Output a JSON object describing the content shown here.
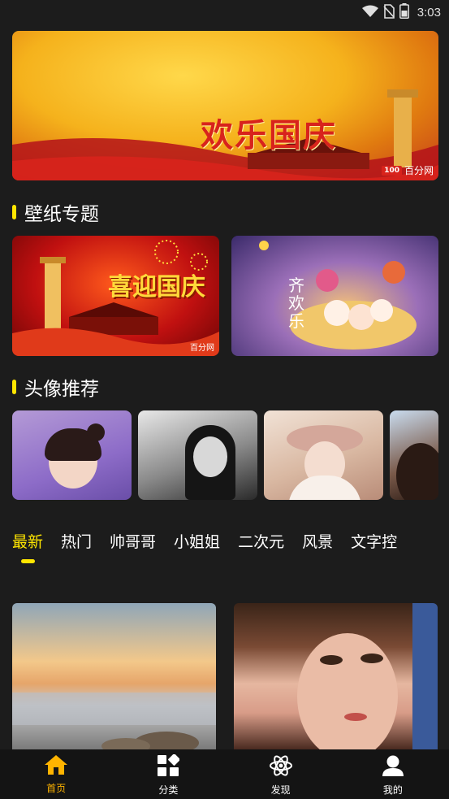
{
  "status_bar": {
    "time": "3:03",
    "icons": [
      "wifi-icon",
      "no-sim-icon",
      "battery-icon"
    ]
  },
  "banner": {
    "title": "欢乐国庆",
    "watermark": "百分网",
    "watermark_logo": "100"
  },
  "wallpaper_section": {
    "title": "壁纸专题",
    "topics": [
      {
        "title": "喜迎国庆",
        "watermark": "百分网"
      },
      {
        "title": "齐欢乐"
      }
    ]
  },
  "avatar_section": {
    "title": "头像推荐",
    "count_visible": 4
  },
  "category_tabs": {
    "items": [
      "最新",
      "热门",
      "帅哥哥",
      "小姐姐",
      "二次元",
      "风景",
      "文字控"
    ],
    "active_index": 0
  },
  "feed": {
    "cards": [
      "seascape-sunset-image",
      "portrait-woman-image"
    ]
  },
  "tab_bar": {
    "items": [
      {
        "label": "首页",
        "icon": "home-icon"
      },
      {
        "label": "分类",
        "icon": "category-grid-icon"
      },
      {
        "label": "发现",
        "icon": "atom-discover-icon"
      },
      {
        "label": "我的",
        "icon": "user-profile-icon"
      }
    ],
    "active_index": 0
  },
  "colors": {
    "background": "#1c1c1c",
    "accent_yellow": "#ffe600",
    "tab_active": "#ffb400",
    "tab_bar_bg": "#141414"
  }
}
